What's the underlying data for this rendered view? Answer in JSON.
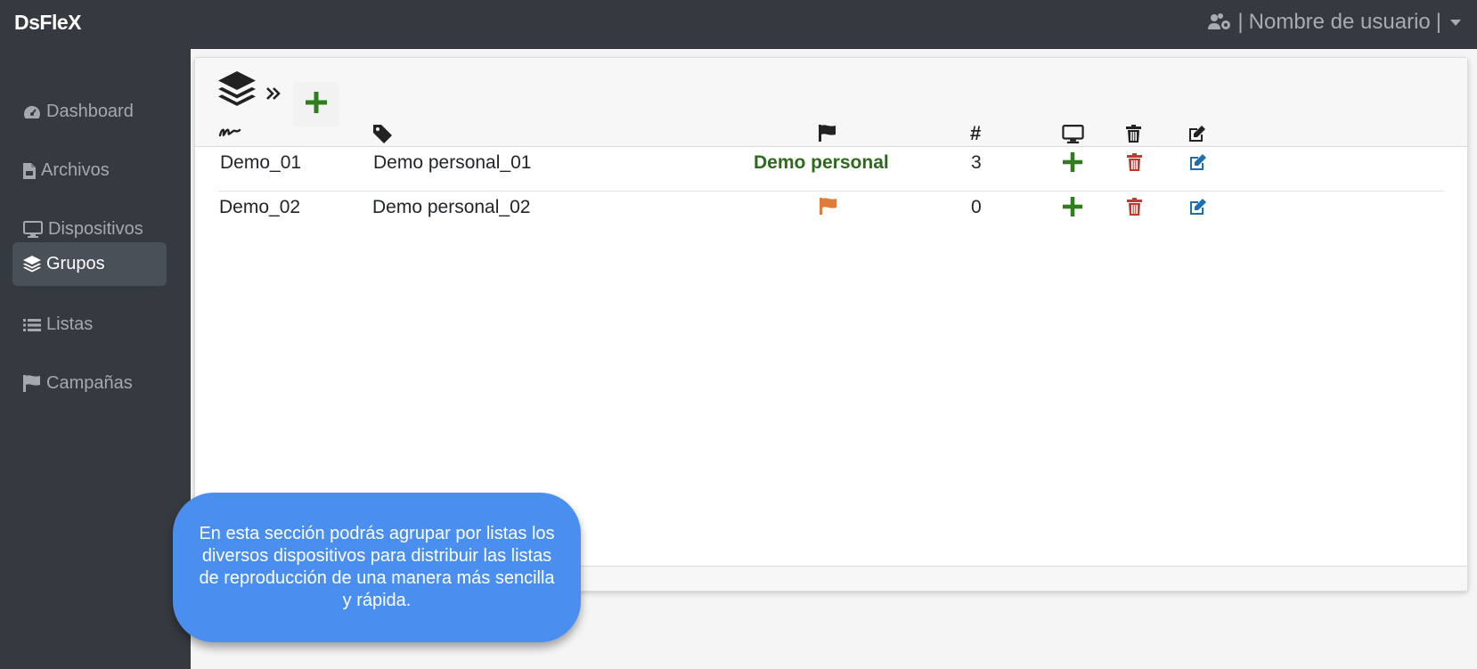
{
  "app": {
    "brand": "DsFleX"
  },
  "user": {
    "separator_left": "|",
    "name": "Nombre de usuario",
    "separator_right": "|"
  },
  "sidebar": {
    "items": [
      {
        "label": "Dashboard",
        "icon": "tachometer-icon",
        "active": false
      },
      {
        "label": "Archivos",
        "icon": "file-icon",
        "active": false
      },
      {
        "label": "Dispositivos",
        "icon": "desktop-icon",
        "active": false
      },
      {
        "label": "Grupos",
        "icon": "layers-icon",
        "active": true
      },
      {
        "label": "Listas",
        "icon": "list-icon",
        "active": false
      },
      {
        "label": "Campañas",
        "icon": "flag-icon",
        "active": false
      }
    ]
  },
  "groups_page": {
    "header_icons": [
      "layers-icon",
      "chevrons-right-icon",
      "plus-icon"
    ],
    "columns": [
      {
        "key": "name",
        "icon": "signature-icon"
      },
      {
        "key": "description",
        "icon": "tag-icon"
      },
      {
        "key": "campaign",
        "icon": "flag-icon"
      },
      {
        "key": "count",
        "label": "#"
      },
      {
        "key": "devices",
        "icon": "desktop-icon"
      },
      {
        "key": "delete",
        "icon": "trash-icon"
      },
      {
        "key": "edit",
        "icon": "edit-icon"
      }
    ],
    "rows": [
      {
        "name": "Demo_01",
        "description": "Demo personal_01",
        "campaign": "Demo personal",
        "count": "3"
      },
      {
        "name": "Demo_02",
        "description": "Demo personal_02",
        "campaign": "",
        "campaign_icon": "flag-icon",
        "count": "0"
      }
    ]
  },
  "tooltip": {
    "text": "En esta sección podrás agrupar por listas los diversos dispositivos para distribuir las listas de reproducción de una manera más sencilla y rápida."
  },
  "colors": {
    "topbar": "#343a40",
    "sidebar": "#343a40",
    "active_item": "#4a5057",
    "add_green": "#2f7d1e",
    "delete_red": "#c0392b",
    "edit_blue": "#1f6fb0",
    "flag_orange": "#e07b39",
    "tooltip_blue": "#4a8ff0"
  }
}
